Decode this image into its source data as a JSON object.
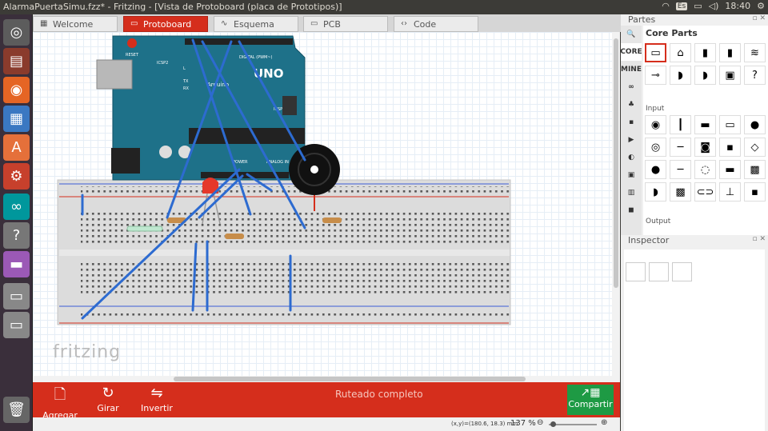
{
  "window": {
    "title": "AlarmaPuertaSimu.fzz* - Fritzing - [Vista de Protoboard (placa de Prototipos)]"
  },
  "system_tray": {
    "keyboard": "Es",
    "time": "18:40"
  },
  "tabs": [
    {
      "label": "Welcome",
      "icon": "grid-icon"
    },
    {
      "label": "Protoboard",
      "icon": "breadboard-icon",
      "active": true
    },
    {
      "label": "Esquema",
      "icon": "schematic-icon"
    },
    {
      "label": "PCB",
      "icon": "pcb-icon"
    },
    {
      "label": "Code",
      "icon": "code-icon"
    }
  ],
  "canvas": {
    "watermark": "fritzing",
    "arduino": {
      "reset_label": "RESET",
      "icsp2_label": "ICSP2",
      "uno_label": "UNO",
      "brand": "Arduino",
      "digital_label": "DIGITAL (PWM~)",
      "icsp_label": "ICSP",
      "power_label": "POWER",
      "analog_label": "ANALOG IN",
      "tx": "TX",
      "rx": "RX",
      "l": "L"
    }
  },
  "toolbar": {
    "add_note": "Agregar nota",
    "rotate": "Girar",
    "flip": "Invertir",
    "routing_status": "Ruteado completo",
    "share": "Compartir"
  },
  "status_bar": {
    "coords": "(x,y)=(180.6, 18.3) mm",
    "zoom": "137 %"
  },
  "parts_panel": {
    "title": "Partes",
    "bin_title": "Core Parts",
    "bins": [
      "CORE",
      "MINE"
    ],
    "section_input": "Input",
    "section_output": "Output"
  },
  "inspector": {
    "title": "Inspector"
  },
  "colors": {
    "accent": "#d52e1c",
    "share": "#1e9a44",
    "wire": "#2d6bd0",
    "arduino": "#1e7189"
  }
}
